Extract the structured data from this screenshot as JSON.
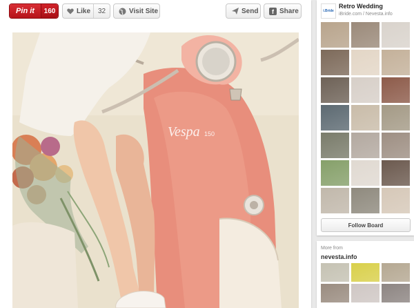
{
  "toolbar": {
    "pinit_label": "Pin it",
    "pinit_count": "160",
    "like_label": "Like",
    "like_count": "32",
    "visit_label": "Visit Site",
    "send_label": "Send",
    "share_label": "Share"
  },
  "board": {
    "logo_text": "i.Bride",
    "title": "Retro Wedding",
    "source": "iBride.com / Nevesta.info",
    "follow_label": "Follow Board",
    "thumb_colors": [
      "#b8a48c",
      "#9b8a7a",
      "#d9d3cc",
      "#7d6a5a",
      "#e3d6c6",
      "#c4b19a",
      "#6e6257",
      "#d7cfc8",
      "#8d5b4a",
      "#5d6a72",
      "#c9bca9",
      "#a49a86",
      "#7a7c6b",
      "#b3a9a0",
      "#9e8f83",
      "#86a06a",
      "#e0d9d1",
      "#6c5a4f",
      "#c1b8ab",
      "#8f8a7e",
      "#d6c8b8"
    ]
  },
  "more": {
    "label": "More from",
    "source": "nevesta.info",
    "thumb_colors": [
      "#c5c2b3",
      "#d9d04b",
      "#b5a892",
      "#9a8c80",
      "#cfc7c4",
      "#8d8582"
    ]
  },
  "colors": {
    "pin_red": "#cb2027",
    "scooter": "#e88e7c",
    "page_bg": "#e9e9e9"
  },
  "icons": {
    "like": "heart-icon",
    "visit": "globe-icon",
    "send": "paper-plane-icon",
    "share": "facebook-icon"
  }
}
